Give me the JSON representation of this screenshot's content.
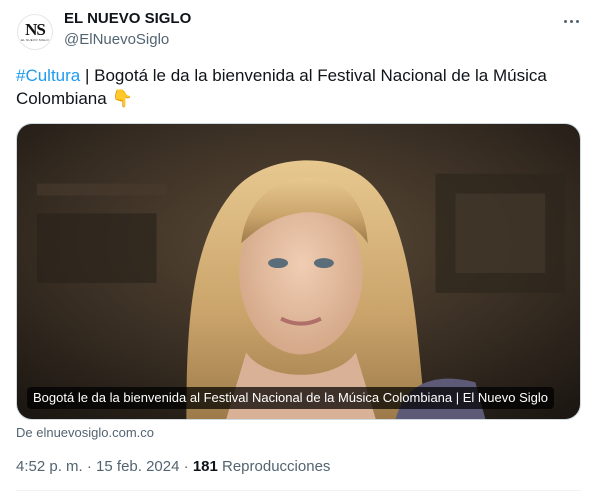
{
  "account": {
    "display_name": "EL NUEVO SIGLO",
    "handle": "@ElNuevoSiglo",
    "avatar_monogram": "NS",
    "avatar_subtext": "EL NUEVO SIGLO"
  },
  "more_icon": "more-horizontal-icon",
  "tweet": {
    "hashtag": "#Cultura",
    "separator": " | ",
    "text": "Bogotá le da la bienvenida al Festival Nacional de la Música Colombiana ",
    "emoji": "👇"
  },
  "card": {
    "title": "Bogotá le da la bienvenida al Festival Nacional de la Música Colombiana | El Nuevo Siglo",
    "domain": "De elnuevosiglo.com.co"
  },
  "meta": {
    "time": "4:52 p. m.",
    "dot1": " · ",
    "date": "15 feb. 2024",
    "dot2": " · ",
    "views_count": "181",
    "views_label": " Reproducciones"
  },
  "colors": {
    "link": "#1d9bf0",
    "secondary_text": "#536471",
    "primary_text": "#0f1419"
  }
}
